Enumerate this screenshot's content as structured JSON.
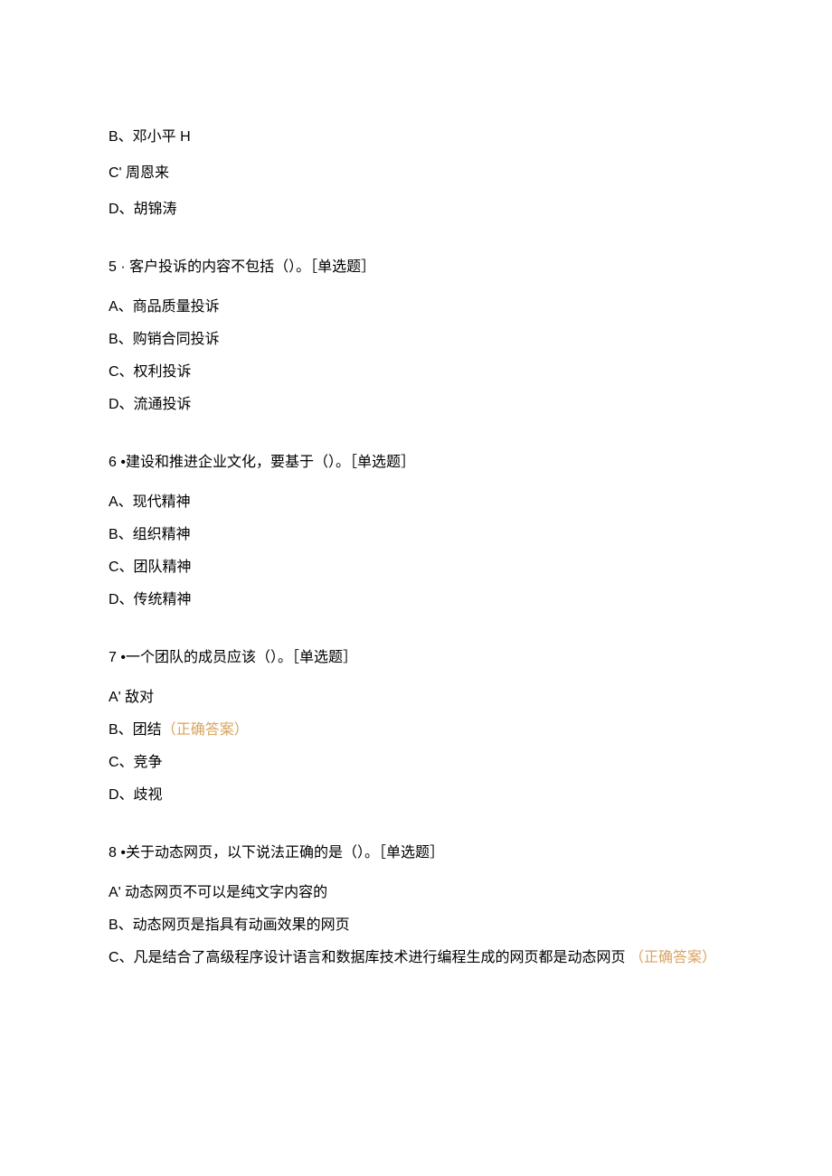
{
  "prelude_options": {
    "b": "B、邓小平 H",
    "c": "C' 周恩来",
    "d": "D、胡锦涛"
  },
  "q5": {
    "stem": "5 · 客户投诉的内容不包括（）。［单选题］",
    "a": "A、商品质量投诉",
    "b": "B、购销合同投诉",
    "c": "C、权利投诉",
    "d": "D、流通投诉"
  },
  "q6": {
    "stem": "6   •建设和推进企业文化，要基于（）。［单选题］",
    "a": "A、现代精神",
    "b": "B、组织精神",
    "c": "C、团队精神",
    "d": "D、传统精神"
  },
  "q7": {
    "stem": "7   •一个团队的成员应该（）。［单选题］",
    "a": "A' 敌对",
    "b_text": "B、团结",
    "b_answer": "（正确答案）",
    "c": "C、竞争",
    "d": "D、歧视"
  },
  "q8": {
    "stem": "8   •关于动态网页，以下说法正确的是（）。［单选题］",
    "a": "A' 动态网页不可以是纯文字内容的",
    "b": "B、动态网页是指具有动画效果的网页",
    "c_text": "C、凡是结合了高级程序设计语言和数据库技术进行编程生成的网页都是动态网页",
    "c_answer": "（正确答案）"
  }
}
